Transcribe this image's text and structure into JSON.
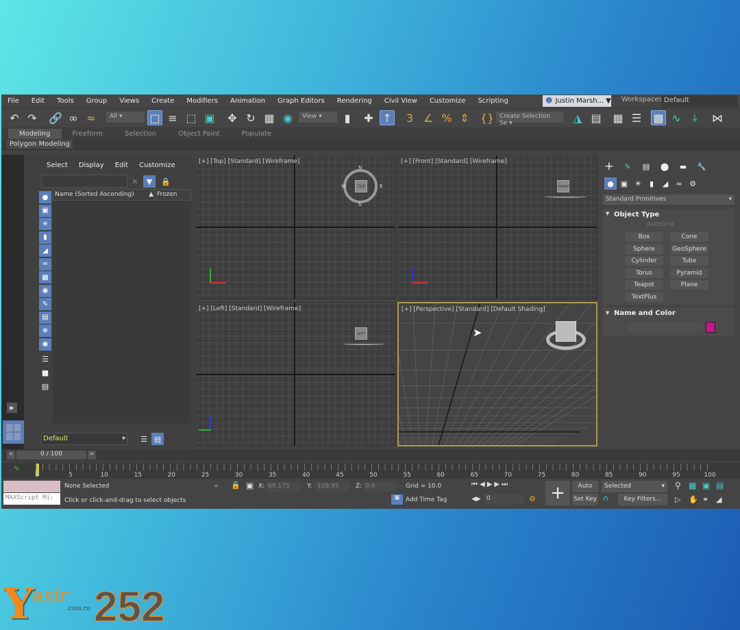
{
  "menu": [
    "File",
    "Edit",
    "Tools",
    "Group",
    "Views",
    "Create",
    "Modifiers",
    "Animation",
    "Graph Editors",
    "Rendering",
    "Civil View",
    "Customize",
    "Scripting"
  ],
  "user": "Justin Marsh...",
  "workspaces_label": "Workspaces:",
  "workspace": "Default",
  "toolbar": {
    "filter": "All",
    "ref_coord": "View",
    "selection_set": "Create Selection Se"
  },
  "ribbon": {
    "tabs": [
      "Modeling",
      "Freeform",
      "Selection",
      "Object Paint",
      "Populate"
    ],
    "active": "Modeling",
    "panel": "Polygon Modeling"
  },
  "scene_explorer": {
    "menu": [
      "Select",
      "Display",
      "Edit",
      "Customize"
    ],
    "col_name": "Name (Sorted Ascending)",
    "col_frozen": "Frozen",
    "layer": "Default"
  },
  "viewports": {
    "top": "[+] [Top] [Standard] [Wireframe]",
    "front": "[+] [Front] [Standard] [Wireframe]",
    "left": "[+] [Left] [Standard] [Wireframe]",
    "perspective": "[+] [Perspective] [Standard] [Default Shading]",
    "active": "perspective"
  },
  "viewcube": {
    "top": "TOP",
    "front": "FRONT",
    "left": "LEFT",
    "compass": [
      "N",
      "S",
      "E",
      "W"
    ]
  },
  "command_panel": {
    "category": "Standard Primitives",
    "object_type": "Object Type",
    "autogrid": "AutoGrid",
    "buttons": [
      "Box",
      "Cone",
      "Sphere",
      "GeoSphere",
      "Cylinder",
      "Tube",
      "Torus",
      "Pyramid",
      "Teapot",
      "Plane",
      "TextPlus"
    ],
    "name_and_color": "Name and Color",
    "object_color": "#c4168a"
  },
  "timeline": {
    "position": "0 / 100",
    "ticks": [
      "0",
      "5",
      "10",
      "15",
      "20",
      "25",
      "30",
      "35",
      "40",
      "45",
      "50",
      "55",
      "60",
      "65",
      "70",
      "75",
      "80",
      "85",
      "90",
      "95",
      "100"
    ]
  },
  "status": {
    "maxscript": "MAXScript Mi:",
    "selection": "None Selected",
    "prompt": "Click or click-and-drag to select objects",
    "x_label": "X:",
    "x": "69.175",
    "y_label": "Y:",
    "y": "109.95",
    "z_label": "Z:",
    "z": "0.0",
    "grid": "Grid = 10.0",
    "add_time_tag": "Add Time Tag",
    "frame": "0",
    "auto_key": "Auto Key",
    "set_key": "Set Key",
    "key_mode": "Selected",
    "key_filters": "Key Filters..."
  },
  "watermark": {
    "name": "Yasir",
    "number": "252",
    "domain": ".com.ru"
  }
}
